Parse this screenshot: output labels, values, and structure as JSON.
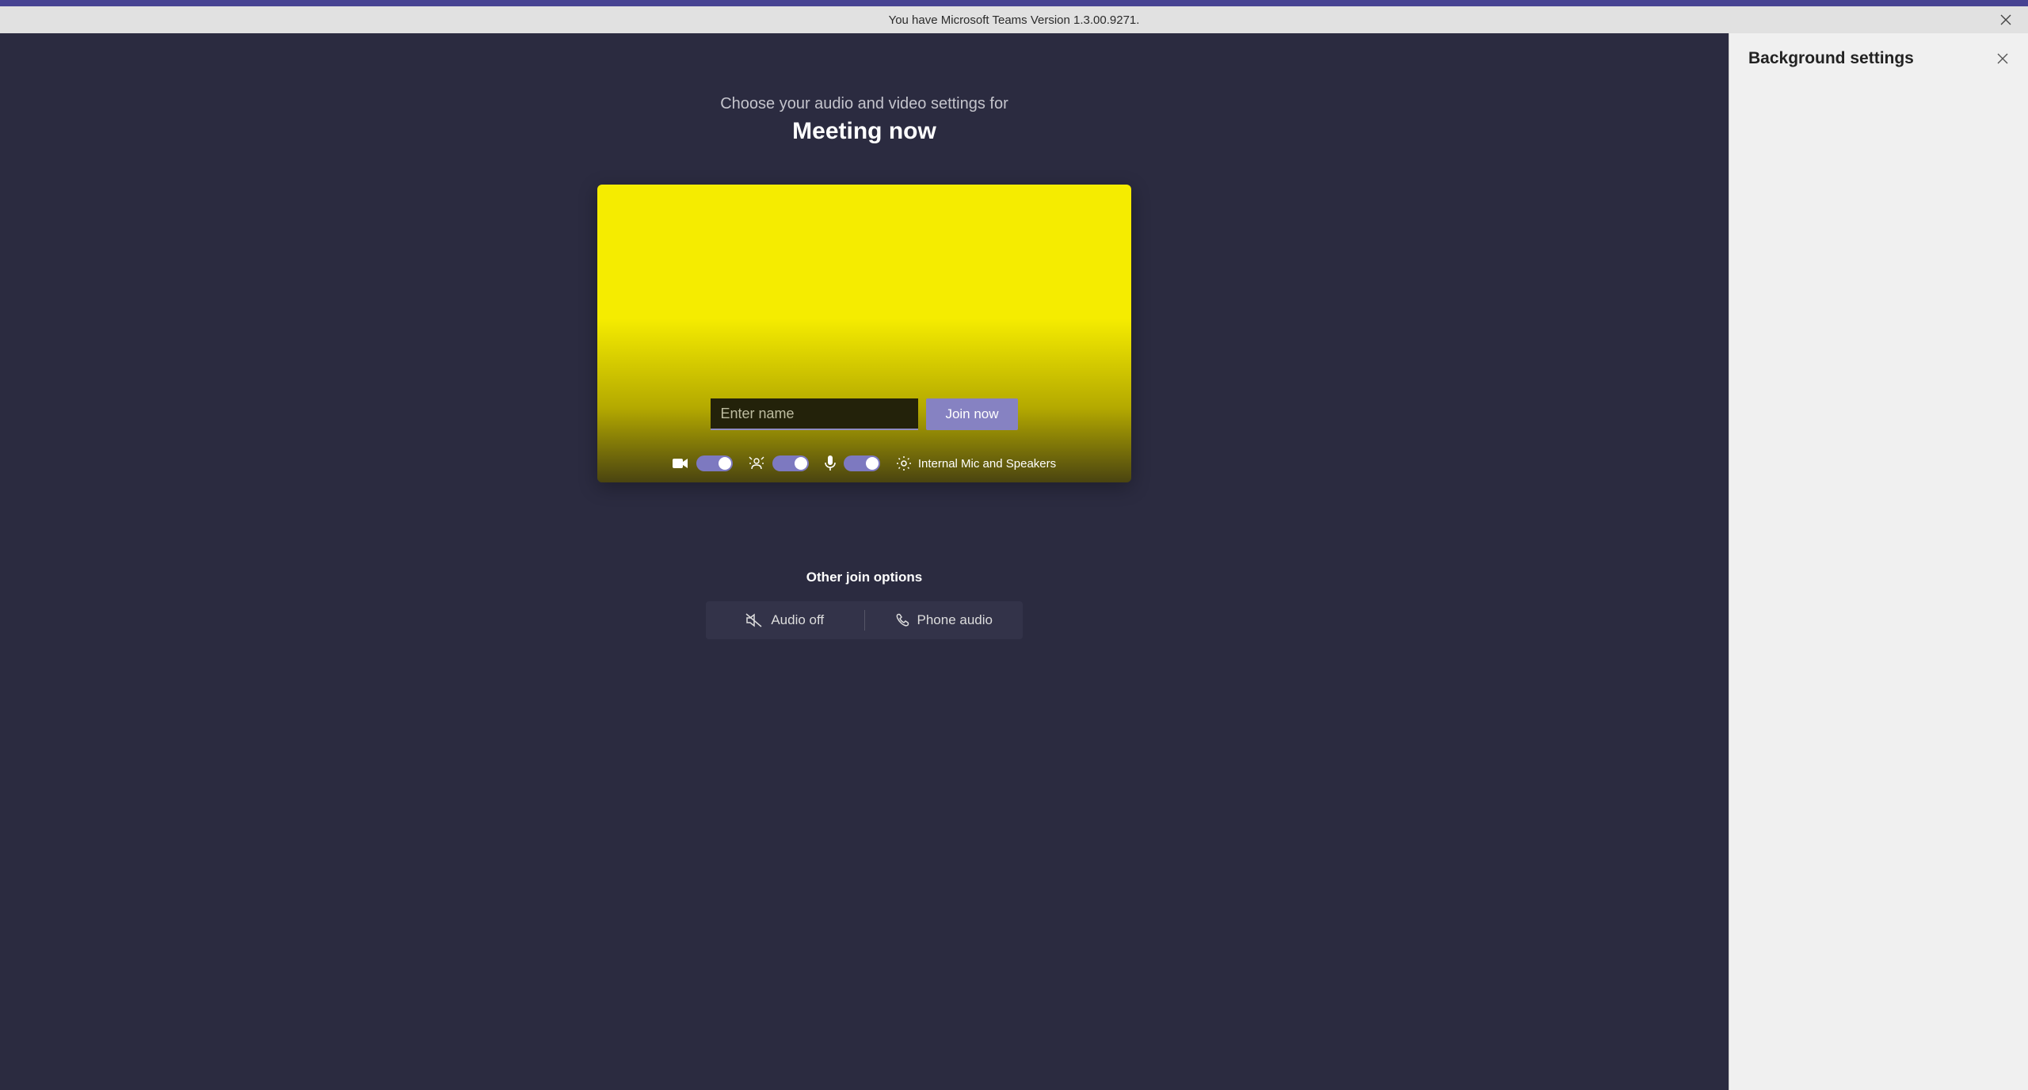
{
  "notification": {
    "text": "You have Microsoft Teams Version 1.3.00.9271."
  },
  "prejoin": {
    "subtitle": "Choose your audio and video settings for",
    "title": "Meeting now",
    "name_placeholder": "Enter name",
    "join_label": "Join now",
    "device_label": "Internal Mic and Speakers"
  },
  "other_options": {
    "title": "Other join options",
    "audio_off": "Audio off",
    "phone_audio": "Phone audio"
  },
  "side_panel": {
    "title": "Background settings"
  }
}
